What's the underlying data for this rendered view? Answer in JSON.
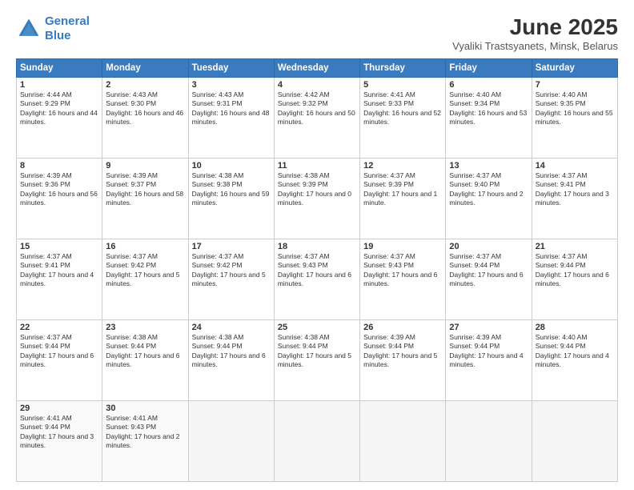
{
  "logo": {
    "line1": "General",
    "line2": "Blue"
  },
  "title": "June 2025",
  "subtitle": "Vyaliki Trastsyanets, Minsk, Belarus",
  "days_header": [
    "Sunday",
    "Monday",
    "Tuesday",
    "Wednesday",
    "Thursday",
    "Friday",
    "Saturday"
  ],
  "weeks": [
    [
      {
        "num": "1",
        "rise": "4:44 AM",
        "set": "9:29 PM",
        "daylight": "16 hours and 44 minutes."
      },
      {
        "num": "2",
        "rise": "4:43 AM",
        "set": "9:30 PM",
        "daylight": "16 hours and 46 minutes."
      },
      {
        "num": "3",
        "rise": "4:43 AM",
        "set": "9:31 PM",
        "daylight": "16 hours and 48 minutes."
      },
      {
        "num": "4",
        "rise": "4:42 AM",
        "set": "9:32 PM",
        "daylight": "16 hours and 50 minutes."
      },
      {
        "num": "5",
        "rise": "4:41 AM",
        "set": "9:33 PM",
        "daylight": "16 hours and 52 minutes."
      },
      {
        "num": "6",
        "rise": "4:40 AM",
        "set": "9:34 PM",
        "daylight": "16 hours and 53 minutes."
      },
      {
        "num": "7",
        "rise": "4:40 AM",
        "set": "9:35 PM",
        "daylight": "16 hours and 55 minutes."
      }
    ],
    [
      {
        "num": "8",
        "rise": "4:39 AM",
        "set": "9:36 PM",
        "daylight": "16 hours and 56 minutes."
      },
      {
        "num": "9",
        "rise": "4:39 AM",
        "set": "9:37 PM",
        "daylight": "16 hours and 58 minutes."
      },
      {
        "num": "10",
        "rise": "4:38 AM",
        "set": "9:38 PM",
        "daylight": "16 hours and 59 minutes."
      },
      {
        "num": "11",
        "rise": "4:38 AM",
        "set": "9:39 PM",
        "daylight": "17 hours and 0 minutes."
      },
      {
        "num": "12",
        "rise": "4:37 AM",
        "set": "9:39 PM",
        "daylight": "17 hours and 1 minute."
      },
      {
        "num": "13",
        "rise": "4:37 AM",
        "set": "9:40 PM",
        "daylight": "17 hours and 2 minutes."
      },
      {
        "num": "14",
        "rise": "4:37 AM",
        "set": "9:41 PM",
        "daylight": "17 hours and 3 minutes."
      }
    ],
    [
      {
        "num": "15",
        "rise": "4:37 AM",
        "set": "9:41 PM",
        "daylight": "17 hours and 4 minutes."
      },
      {
        "num": "16",
        "rise": "4:37 AM",
        "set": "9:42 PM",
        "daylight": "17 hours and 5 minutes."
      },
      {
        "num": "17",
        "rise": "4:37 AM",
        "set": "9:42 PM",
        "daylight": "17 hours and 5 minutes."
      },
      {
        "num": "18",
        "rise": "4:37 AM",
        "set": "9:43 PM",
        "daylight": "17 hours and 6 minutes."
      },
      {
        "num": "19",
        "rise": "4:37 AM",
        "set": "9:43 PM",
        "daylight": "17 hours and 6 minutes."
      },
      {
        "num": "20",
        "rise": "4:37 AM",
        "set": "9:44 PM",
        "daylight": "17 hours and 6 minutes."
      },
      {
        "num": "21",
        "rise": "4:37 AM",
        "set": "9:44 PM",
        "daylight": "17 hours and 6 minutes."
      }
    ],
    [
      {
        "num": "22",
        "rise": "4:37 AM",
        "set": "9:44 PM",
        "daylight": "17 hours and 6 minutes."
      },
      {
        "num": "23",
        "rise": "4:38 AM",
        "set": "9:44 PM",
        "daylight": "17 hours and 6 minutes."
      },
      {
        "num": "24",
        "rise": "4:38 AM",
        "set": "9:44 PM",
        "daylight": "17 hours and 6 minutes."
      },
      {
        "num": "25",
        "rise": "4:38 AM",
        "set": "9:44 PM",
        "daylight": "17 hours and 5 minutes."
      },
      {
        "num": "26",
        "rise": "4:39 AM",
        "set": "9:44 PM",
        "daylight": "17 hours and 5 minutes."
      },
      {
        "num": "27",
        "rise": "4:39 AM",
        "set": "9:44 PM",
        "daylight": "17 hours and 4 minutes."
      },
      {
        "num": "28",
        "rise": "4:40 AM",
        "set": "9:44 PM",
        "daylight": "17 hours and 4 minutes."
      }
    ],
    [
      {
        "num": "29",
        "rise": "4:41 AM",
        "set": "9:44 PM",
        "daylight": "17 hours and 3 minutes."
      },
      {
        "num": "30",
        "rise": "4:41 AM",
        "set": "9:43 PM",
        "daylight": "17 hours and 2 minutes."
      },
      null,
      null,
      null,
      null,
      null
    ]
  ]
}
